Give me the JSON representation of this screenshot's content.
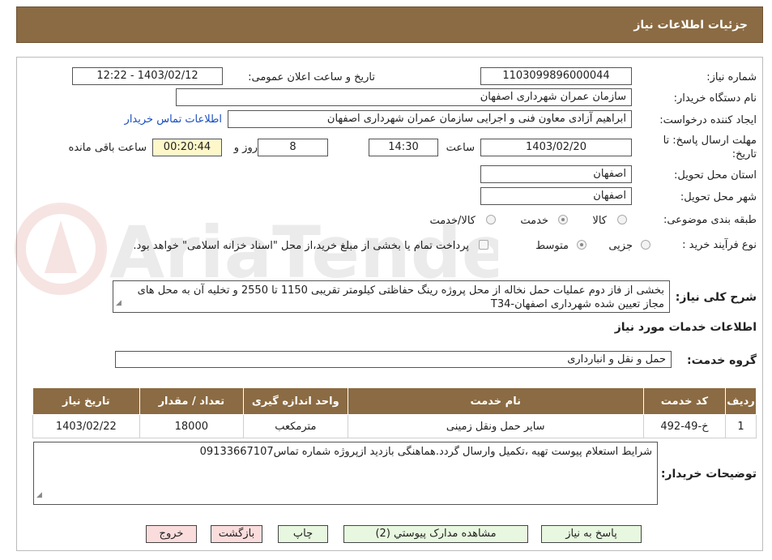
{
  "header": {
    "title": "جزئیات اطلاعات نیاز"
  },
  "need": {
    "number_label": "شماره نیاز:",
    "number": "1103099896000044",
    "announce_label": "تاریخ و ساعت اعلان عمومی:",
    "announce_value": "1403/02/12 - 12:22",
    "buyer_org_label": "نام دستگاه خریدار:",
    "buyer_org": "سازمان عمران شهرداری اصفهان",
    "creator_label": "ایجاد کننده درخواست:",
    "creator": "ابراهیم آزادی معاون فنی و اجرایی سازمان عمران شهرداری اصفهان",
    "contact_link": "اطلاعات تماس خریدار",
    "deadline_label_line1": "مهلت ارسال پاسخ: تا",
    "deadline_label_line2": "تاریخ:",
    "deadline_date": "1403/02/20",
    "time_word": "ساعت",
    "deadline_time": "14:30",
    "days": "8",
    "days_word": "روز و",
    "remaining": "00:20:44",
    "remaining_word": "ساعت باقی مانده",
    "province_label": "استان محل تحویل:",
    "province": "اصفهان",
    "city_label": "شهر محل تحویل:",
    "city": "اصفهان",
    "category_label": "طبقه بندی موضوعی:",
    "category_options": [
      "کالا",
      "خدمت",
      "کالا/خدمت"
    ],
    "process_label": "نوع فرآیند خرید :",
    "process_options": [
      "جزیی",
      "متوسط"
    ],
    "payment_note": "پرداخت تمام یا بخشی از مبلغ خرید،از محل \"اسناد خزانه اسلامی\" خواهد بود.",
    "summary_label": "شرح کلی نیاز:",
    "summary": "بخشی از فاز دوم عملیات حمل نخاله از محل پروژه رینگ حفاظتی کیلومتر تقریبی 1150 تا 2550 و تخلیه آن به محل های مجاز تعیین شده شهرداری اصفهان-T34"
  },
  "services": {
    "section_title": "اطلاعات خدمات مورد نیاز",
    "group_label": "گروه خدمت:",
    "group_value": "حمل و نقل و انبارداری",
    "columns": [
      "ردیف",
      "کد خدمت",
      "نام خدمت",
      "واحد اندازه گیری",
      "تعداد / مقدار",
      "تاریخ نیاز"
    ],
    "rows": [
      [
        "1",
        "خ-49-492",
        "سایر حمل ونقل زمینی",
        "مترمکعب",
        "18000",
        "1403/02/22"
      ]
    ]
  },
  "notes": {
    "label": "توضیحات خریدار:",
    "text": "شرایط استعلام پیوست تهیه ،تکمیل وارسال گردد.هماهنگی بازدید ازپروژه شماره تماس09133667107"
  },
  "buttons": {
    "reply": "پاسخ به نیاز",
    "docs": "مشاهده مدارک پیوستي (2)",
    "print": "چاپ",
    "back": "بازگشت",
    "exit": "خروج"
  },
  "watermark": {
    "text": "AriaTender.neT"
  },
  "colors": {
    "header_bg": "#8b6b43",
    "link": "#1a4fbf",
    "remaining_bg": "#fdf7c9"
  }
}
